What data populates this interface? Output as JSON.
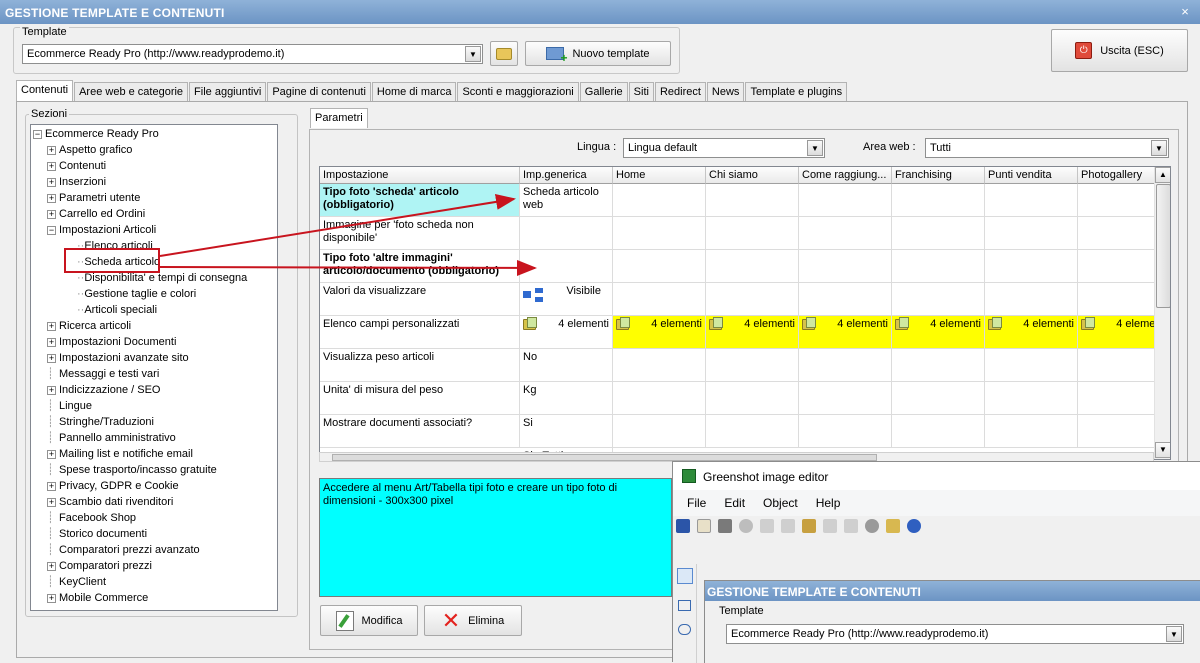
{
  "window": {
    "title": "GESTIONE TEMPLATE E CONTENUTI",
    "close": "×"
  },
  "template": {
    "group_label": "Template",
    "selected": "Ecommerce Ready Pro (http://www.readyprodemo.it)",
    "new_button": "Nuovo template",
    "exit_button": "Uscita (ESC)"
  },
  "tabs": [
    "Contenuti",
    "Aree web e categorie",
    "File aggiuntivi",
    "Pagine di contenuti",
    "Home di marca",
    "Sconti e maggiorazioni",
    "Gallerie",
    "Siti",
    "Redirect",
    "News",
    "Template e plugins"
  ],
  "sections": {
    "label": "Sezioni",
    "root": "Ecommerce Ready Pro",
    "items": [
      {
        "label": "Aspetto grafico",
        "expand": "+"
      },
      {
        "label": "Contenuti",
        "expand": "+"
      },
      {
        "label": "Inserzioni",
        "expand": "+"
      },
      {
        "label": "Parametri utente",
        "expand": "+"
      },
      {
        "label": "Carrello ed Ordini",
        "expand": "+"
      },
      {
        "label": "Impostazioni Articoli",
        "expand": "-"
      },
      {
        "label": "Elenco articoli",
        "child": true
      },
      {
        "label": "Scheda articolo",
        "child": true,
        "selected": true
      },
      {
        "label": "Disponibilita' e tempi di consegna",
        "child": true
      },
      {
        "label": "Gestione taglie e colori",
        "child": true
      },
      {
        "label": "Articoli speciali",
        "child": true
      },
      {
        "label": "Ricerca articoli",
        "expand": "+"
      },
      {
        "label": "Impostazioni Documenti",
        "expand": "+"
      },
      {
        "label": "Impostazioni avanzate sito",
        "expand": "+"
      },
      {
        "label": "Messaggi e testi vari"
      },
      {
        "label": "Indicizzazione / SEO",
        "expand": "+"
      },
      {
        "label": "Lingue"
      },
      {
        "label": "Stringhe/Traduzioni"
      },
      {
        "label": "Pannello amministrativo"
      },
      {
        "label": "Mailing list e notifiche email",
        "expand": "+"
      },
      {
        "label": "Spese trasporto/incasso gratuite"
      },
      {
        "label": "Privacy, GDPR e Cookie",
        "expand": "+"
      },
      {
        "label": "Scambio dati rivenditori",
        "expand": "+"
      },
      {
        "label": "Facebook Shop"
      },
      {
        "label": "Storico documenti"
      },
      {
        "label": "Comparatori prezzi avanzato"
      },
      {
        "label": "Comparatori prezzi",
        "expand": "+"
      },
      {
        "label": "KeyClient"
      },
      {
        "label": "Mobile Commerce",
        "expand": "+"
      }
    ]
  },
  "params": {
    "tab": "Parametri",
    "lingua_label": "Lingua :",
    "lingua_value": "Lingua default",
    "area_label": "Area web :",
    "area_value": "Tutti",
    "columns": [
      "Impostazione",
      "Imp.generica",
      "Home",
      "Chi siamo",
      "Come raggiung...",
      "Franchising",
      "Punti vendita",
      "Photogallery"
    ],
    "rows": [
      {
        "name": "Tipo foto 'scheda' articolo (obbligatorio)",
        "value": "Scheda articolo web",
        "bold": true,
        "highlight": true
      },
      {
        "name": "Immagine per 'foto scheda non disponibile'",
        "value": ""
      },
      {
        "name": "Tipo foto 'altre immagini' articolo/documento (obbligatorio)",
        "value": "",
        "bold": true
      },
      {
        "name": "Valori da visualizzare",
        "value": "Visibile",
        "icon": true
      },
      {
        "name": "Elenco campi personalizzati",
        "value": "4 elementi",
        "folder": true,
        "others": "4 elementi"
      },
      {
        "name": "Visualizza peso articoli",
        "value": "No"
      },
      {
        "name": "Unita' di misura del peso",
        "value": "Kg"
      },
      {
        "name": "Mostrare documenti associati?",
        "value": "Si"
      }
    ],
    "last_partial": "Si - Tutti ..."
  },
  "description": "Accedere al menu Art/Tabella tipi foto e creare un tipo foto di dimensioni - 300x300 pixel",
  "buttons": {
    "edit": "Modifica",
    "delete": "Elimina"
  },
  "greenshot": {
    "title": "Greenshot image editor",
    "menu": [
      "File",
      "Edit",
      "Object",
      "Help"
    ],
    "inner_title": "GESTIONE TEMPLATE E CONTENUTI",
    "inner_label": "Template",
    "inner_selected": "Ecommerce Ready Pro (http://www.readyprodemo.it)"
  }
}
